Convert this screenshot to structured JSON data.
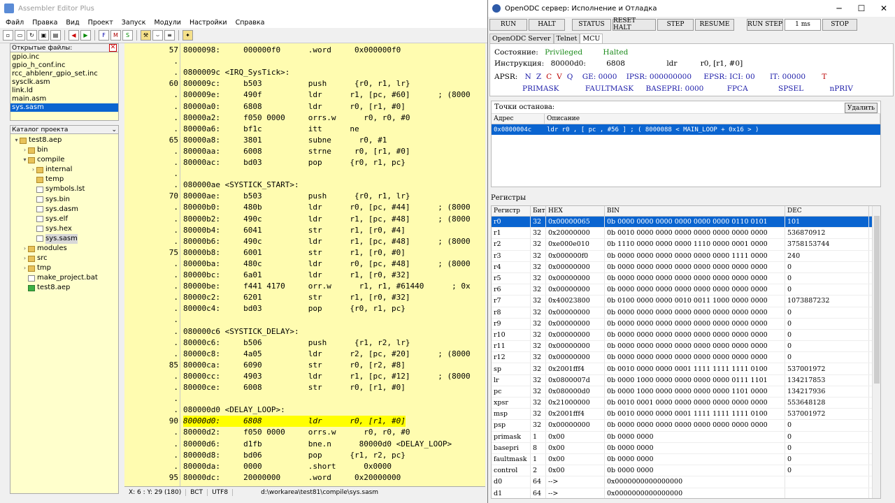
{
  "main_window": {
    "title": "Assembler Editor Plus",
    "menu": [
      "Файл",
      "Правка",
      "Вид",
      "Проект",
      "Запуск",
      "Модули",
      "Настройки",
      "Справка"
    ]
  },
  "open_files": {
    "header": "Открытые файлы:",
    "items": [
      "gpio.inc",
      "gpio_h_conf.inc",
      "rcc_ahblenr_gpio_set.inc",
      "sysclk.asm",
      "link.ld",
      "main.asm",
      "sys.sasm"
    ],
    "selected": "sys.sasm"
  },
  "project_tree": {
    "header": "Каталог проекта",
    "nodes": [
      {
        "label": "test8.aep",
        "depth": 0,
        "type": "folder",
        "twisty": "▾"
      },
      {
        "label": "bin",
        "depth": 1,
        "type": "folder",
        "twisty": "›"
      },
      {
        "label": "compile",
        "depth": 1,
        "type": "folder",
        "twisty": "▾"
      },
      {
        "label": "internal",
        "depth": 2,
        "type": "folder",
        "twisty": "›"
      },
      {
        "label": "temp",
        "depth": 2,
        "type": "folder",
        "twisty": ""
      },
      {
        "label": "symbols.lst",
        "depth": 2,
        "type": "file",
        "twisty": ""
      },
      {
        "label": "sys.bin",
        "depth": 2,
        "type": "file",
        "twisty": ""
      },
      {
        "label": "sys.dasm",
        "depth": 2,
        "type": "file",
        "twisty": ""
      },
      {
        "label": "sys.elf",
        "depth": 2,
        "type": "file",
        "twisty": ""
      },
      {
        "label": "sys.hex",
        "depth": 2,
        "type": "file",
        "twisty": ""
      },
      {
        "label": "sys.sasm",
        "depth": 2,
        "type": "file",
        "twisty": "",
        "selected": true
      },
      {
        "label": "modules",
        "depth": 1,
        "type": "folder",
        "twisty": "›"
      },
      {
        "label": "src",
        "depth": 1,
        "type": "folder",
        "twisty": "›"
      },
      {
        "label": "tmp",
        "depth": 1,
        "type": "folder",
        "twisty": "›"
      },
      {
        "label": "make_project.bat",
        "depth": 1,
        "type": "file",
        "twisty": ""
      },
      {
        "label": "test8.aep",
        "depth": 1,
        "type": "proj",
        "twisty": ""
      }
    ]
  },
  "editor": {
    "lines": [
      {
        "ln": "57",
        "code": "8000098:     000000f0      .word     0x000000f0"
      },
      {
        "ln": ".",
        "code": ""
      },
      {
        "ln": ".",
        "code": "0800009c <IRQ_SysTick>:"
      },
      {
        "ln": "60",
        "code": "800009c:     b503          push      {r0, r1, lr}"
      },
      {
        "ln": ".",
        "code": "800009e:     490f          ldr      r1, [pc, #60]      ; (8000"
      },
      {
        "ln": ".",
        "code": "80000a0:     6808          ldr      r0, [r1, #0]"
      },
      {
        "ln": ".",
        "code": "80000a2:     f050 0000     orrs.w      r0, r0, #0"
      },
      {
        "ln": ".",
        "code": "80000a6:     bf1c          itt      ne"
      },
      {
        "ln": "65",
        "code": "80000a8:     3801          subne      r0, #1"
      },
      {
        "ln": ".",
        "code": "80000aa:     6008          strne     r0, [r1, #0]"
      },
      {
        "ln": ".",
        "code": "80000ac:     bd03          pop      {r0, r1, pc}"
      },
      {
        "ln": ".",
        "code": ""
      },
      {
        "ln": ".",
        "code": "080000ae <SYSTICK_START>:"
      },
      {
        "ln": "70",
        "code": "80000ae:     b503          push      {r0, r1, lr}"
      },
      {
        "ln": ".",
        "code": "80000b0:     480b          ldr      r0, [pc, #44]      ; (8000"
      },
      {
        "ln": ".",
        "code": "80000b2:     490c          ldr      r1, [pc, #48]      ; (8000"
      },
      {
        "ln": ".",
        "code": "80000b4:     6041          str      r1, [r0, #4]"
      },
      {
        "ln": ".",
        "code": "80000b6:     490c          ldr      r1, [pc, #48]      ; (8000"
      },
      {
        "ln": "75",
        "code": "80000b8:     6001          str      r1, [r0, #0]"
      },
      {
        "ln": ".",
        "code": "80000ba:     480c          ldr      r0, [pc, #48]      ; (8000"
      },
      {
        "ln": ".",
        "code": "80000bc:     6a01          ldr      r1, [r0, #32]"
      },
      {
        "ln": ".",
        "code": "80000be:     f441 4170     orr.w      r1, r1, #61440      ; 0x"
      },
      {
        "ln": ".",
        "code": "80000c2:     6201          str      r1, [r0, #32]"
      },
      {
        "ln": ".",
        "code": "80000c4:     bd03          pop      {r0, r1, pc}"
      },
      {
        "ln": ".",
        "code": ""
      },
      {
        "ln": ".",
        "code": "080000c6 <SYSTICK_DELAY>:"
      },
      {
        "ln": ".",
        "code": "80000c6:     b506          push      {r1, r2, lr}"
      },
      {
        "ln": ".",
        "code": "80000c8:     4a05          ldr      r2, [pc, #20]      ; (8000"
      },
      {
        "ln": "85",
        "code": "80000ca:     6090          str      r0, [r2, #8]"
      },
      {
        "ln": ".",
        "code": "80000cc:     4903          ldr      r1, [pc, #12]      ; (8000"
      },
      {
        "ln": ".",
        "code": "80000ce:     6008          str      r0, [r1, #0]"
      },
      {
        "ln": ".",
        "code": ""
      },
      {
        "ln": ".",
        "code": "080000d0 <DELAY_LOOP>:"
      },
      {
        "ln": "90",
        "code": "80000d0:     6808          ldr      r0, [r1, #0]",
        "highlight": true
      },
      {
        "ln": ".",
        "code": "80000d2:     f050 0000     orrs.w      r0, r0, #0"
      },
      {
        "ln": ".",
        "code": "80000d6:     d1fb          bne.n      80000d0 <DELAY_LOOP>"
      },
      {
        "ln": ".",
        "code": "80000d8:     bd06          pop      {r1, r2, pc}"
      },
      {
        "ln": ".",
        "code": "80000da:     0000          .short      0x0000"
      },
      {
        "ln": "95",
        "code": "80000dc:     20000000      .word     0x20000000"
      }
    ]
  },
  "statusbar": {
    "position": "X: 6 : Y: 29 (180)",
    "ins": "BCT",
    "encoding": "UTF8",
    "path": "d:\\workarea\\test81\\compile\\sys.sasm"
  },
  "ocd": {
    "title": "OpenODC сервер: Исполнение и Отладка",
    "buttons": [
      "RUN",
      "HALT",
      "STATUS",
      "RESET HALT",
      "STEP",
      "RESUME",
      "RUN STEP",
      "1 ms",
      "STOP"
    ],
    "tabs": [
      "OpenODC Server",
      "Telnet",
      "MCU"
    ],
    "state_label": "Состояние:",
    "state_priv": "Privileged",
    "state_halt": "Halted",
    "instr_label": "Инструкция:",
    "instr_addr": "80000d0:",
    "instr_hex": "6808",
    "instr_mn": "ldr",
    "instr_ops": "r0, [r1, #0]",
    "apsr_label": "APSR:",
    "apsr_flags": [
      "N",
      "Z",
      "C",
      "V",
      "Q"
    ],
    "ge": "GE: 0000",
    "ipsr": "IPSR: 000000000",
    "epsr": "EPSR: ICI: 00",
    "it": "IT: 00000",
    "t_flag": "T",
    "primask": "PRIMASK",
    "faultmask": "FAULTMASK",
    "basepri": "BASEPRI: 0000",
    "fpca": "FPCA",
    "spsel": "SPSEL",
    "npriv": "nPRIV",
    "colors": {
      "accent": "#0a64d0",
      "editor_bg": "#fffcb0",
      "highlight": "#ffff00",
      "blue": "#1a1aa8",
      "green": "#1a8a1a",
      "red": "#b00000"
    }
  },
  "breakpoints": {
    "header": "Точки останова:",
    "delete_label": "Удалить",
    "col_addr": "Адрес",
    "col_desc": "Описание",
    "rows": [
      {
        "addr": "0x0800004c",
        "desc": "ldr r0 , [ pc , #56 ] ; ( 8000088 < MAIN_LOOP + 0x16 > )"
      }
    ]
  },
  "registers": {
    "header": "Регистры",
    "columns": [
      "Регистр",
      "Бит",
      "HEX",
      "BIN",
      "DEC"
    ],
    "rows": [
      {
        "name": "r0",
        "bits": "32",
        "hex": "0x00000065",
        "bin": "0b 0000 0000 0000 0000 0000 0000 0110 0101",
        "dec": "101",
        "selected": true
      },
      {
        "name": "r1",
        "bits": "32",
        "hex": "0x20000000",
        "bin": "0b 0010 0000 0000 0000 0000 0000 0000 0000",
        "dec": "536870912"
      },
      {
        "name": "r2",
        "bits": "32",
        "hex": "0xe000e010",
        "bin": "0b 1110 0000 0000 0000 1110 0000 0001 0000",
        "dec": "3758153744"
      },
      {
        "name": "r3",
        "bits": "32",
        "hex": "0x000000f0",
        "bin": "0b 0000 0000 0000 0000 0000 0000 1111 0000",
        "dec": "240"
      },
      {
        "name": "r4",
        "bits": "32",
        "hex": "0x00000000",
        "bin": "0b 0000 0000 0000 0000 0000 0000 0000 0000",
        "dec": "0"
      },
      {
        "name": "r5",
        "bits": "32",
        "hex": "0x00000000",
        "bin": "0b 0000 0000 0000 0000 0000 0000 0000 0000",
        "dec": "0"
      },
      {
        "name": "r6",
        "bits": "32",
        "hex": "0x00000000",
        "bin": "0b 0000 0000 0000 0000 0000 0000 0000 0000",
        "dec": "0"
      },
      {
        "name": "r7",
        "bits": "32",
        "hex": "0x40023800",
        "bin": "0b 0100 0000 0000 0010 0011 1000 0000 0000",
        "dec": "1073887232"
      },
      {
        "name": "r8",
        "bits": "32",
        "hex": "0x00000000",
        "bin": "0b 0000 0000 0000 0000 0000 0000 0000 0000",
        "dec": "0"
      },
      {
        "name": "r9",
        "bits": "32",
        "hex": "0x00000000",
        "bin": "0b 0000 0000 0000 0000 0000 0000 0000 0000",
        "dec": "0"
      },
      {
        "name": "r10",
        "bits": "32",
        "hex": "0x00000000",
        "bin": "0b 0000 0000 0000 0000 0000 0000 0000 0000",
        "dec": "0"
      },
      {
        "name": "r11",
        "bits": "32",
        "hex": "0x00000000",
        "bin": "0b 0000 0000 0000 0000 0000 0000 0000 0000",
        "dec": "0"
      },
      {
        "name": "r12",
        "bits": "32",
        "hex": "0x00000000",
        "bin": "0b 0000 0000 0000 0000 0000 0000 0000 0000",
        "dec": "0"
      },
      {
        "name": "sp",
        "bits": "32",
        "hex": "0x2001fff4",
        "bin": "0b 0010 0000 0000 0001 1111 1111 1111 0100",
        "dec": "537001972"
      },
      {
        "name": "lr",
        "bits": "32",
        "hex": "0x0800007d",
        "bin": "0b 0000 1000 0000 0000 0000 0000 0111 1101",
        "dec": "134217853"
      },
      {
        "name": "pc",
        "bits": "32",
        "hex": "0x080000d0",
        "bin": "0b 0000 1000 0000 0000 0000 0000 1101 0000",
        "dec": "134217936"
      },
      {
        "name": "xpsr",
        "bits": "32",
        "hex": "0x21000000",
        "bin": "0b 0010 0001 0000 0000 0000 0000 0000 0000",
        "dec": "553648128"
      },
      {
        "name": "msp",
        "bits": "32",
        "hex": "0x2001fff4",
        "bin": "0b 0010 0000 0000 0001 1111 1111 1111 0100",
        "dec": "537001972"
      },
      {
        "name": "psp",
        "bits": "32",
        "hex": "0x00000000",
        "bin": "0b 0000 0000 0000 0000 0000 0000 0000 0000",
        "dec": "0"
      },
      {
        "name": "primask",
        "bits": "1",
        "hex": "0x00",
        "bin": "0b 0000 0000",
        "dec": "0"
      },
      {
        "name": "basepri",
        "bits": "8",
        "hex": "0x00",
        "bin": "0b 0000 0000",
        "dec": "0"
      },
      {
        "name": "faultmask",
        "bits": "1",
        "hex": "0x00",
        "bin": "0b 0000 0000",
        "dec": "0"
      },
      {
        "name": "control",
        "bits": "2",
        "hex": "0x00",
        "bin": "0b 0000 0000",
        "dec": "0"
      },
      {
        "name": "d0",
        "bits": "64",
        "hex": "-->",
        "bin": "0x0000000000000000",
        "dec": ""
      },
      {
        "name": "d1",
        "bits": "64",
        "hex": "-->",
        "bin": "0x0000000000000000",
        "dec": ""
      }
    ]
  }
}
